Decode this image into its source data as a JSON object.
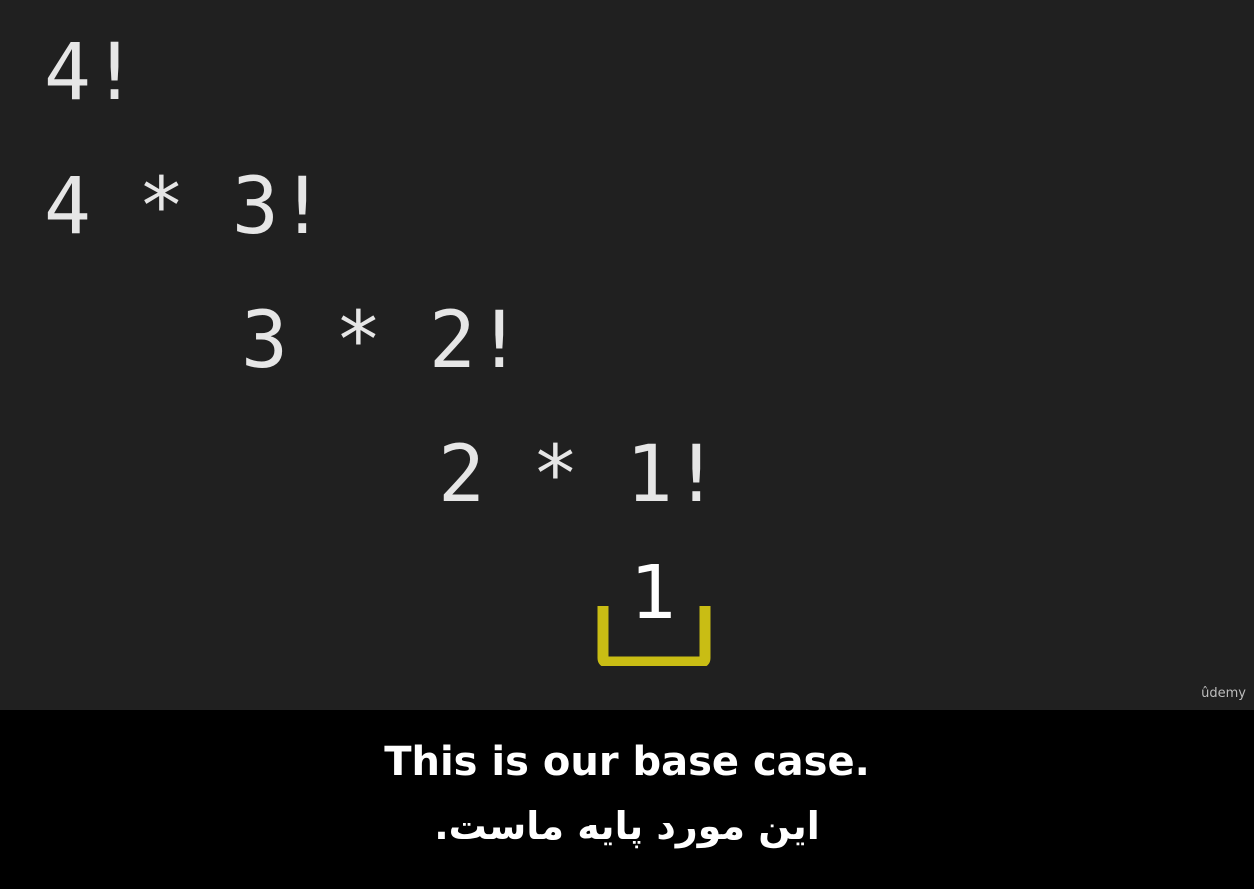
{
  "lesson": {
    "lines": [
      "4!",
      "4 * 3!",
      "3 * 2!",
      "2 * 1!"
    ],
    "base_case_value": "1",
    "bracket_color": "#c9bd14"
  },
  "watermark": "ûdemy",
  "subtitles": {
    "english": "This is our base case.",
    "persian": "این مورد پایه ماست."
  }
}
